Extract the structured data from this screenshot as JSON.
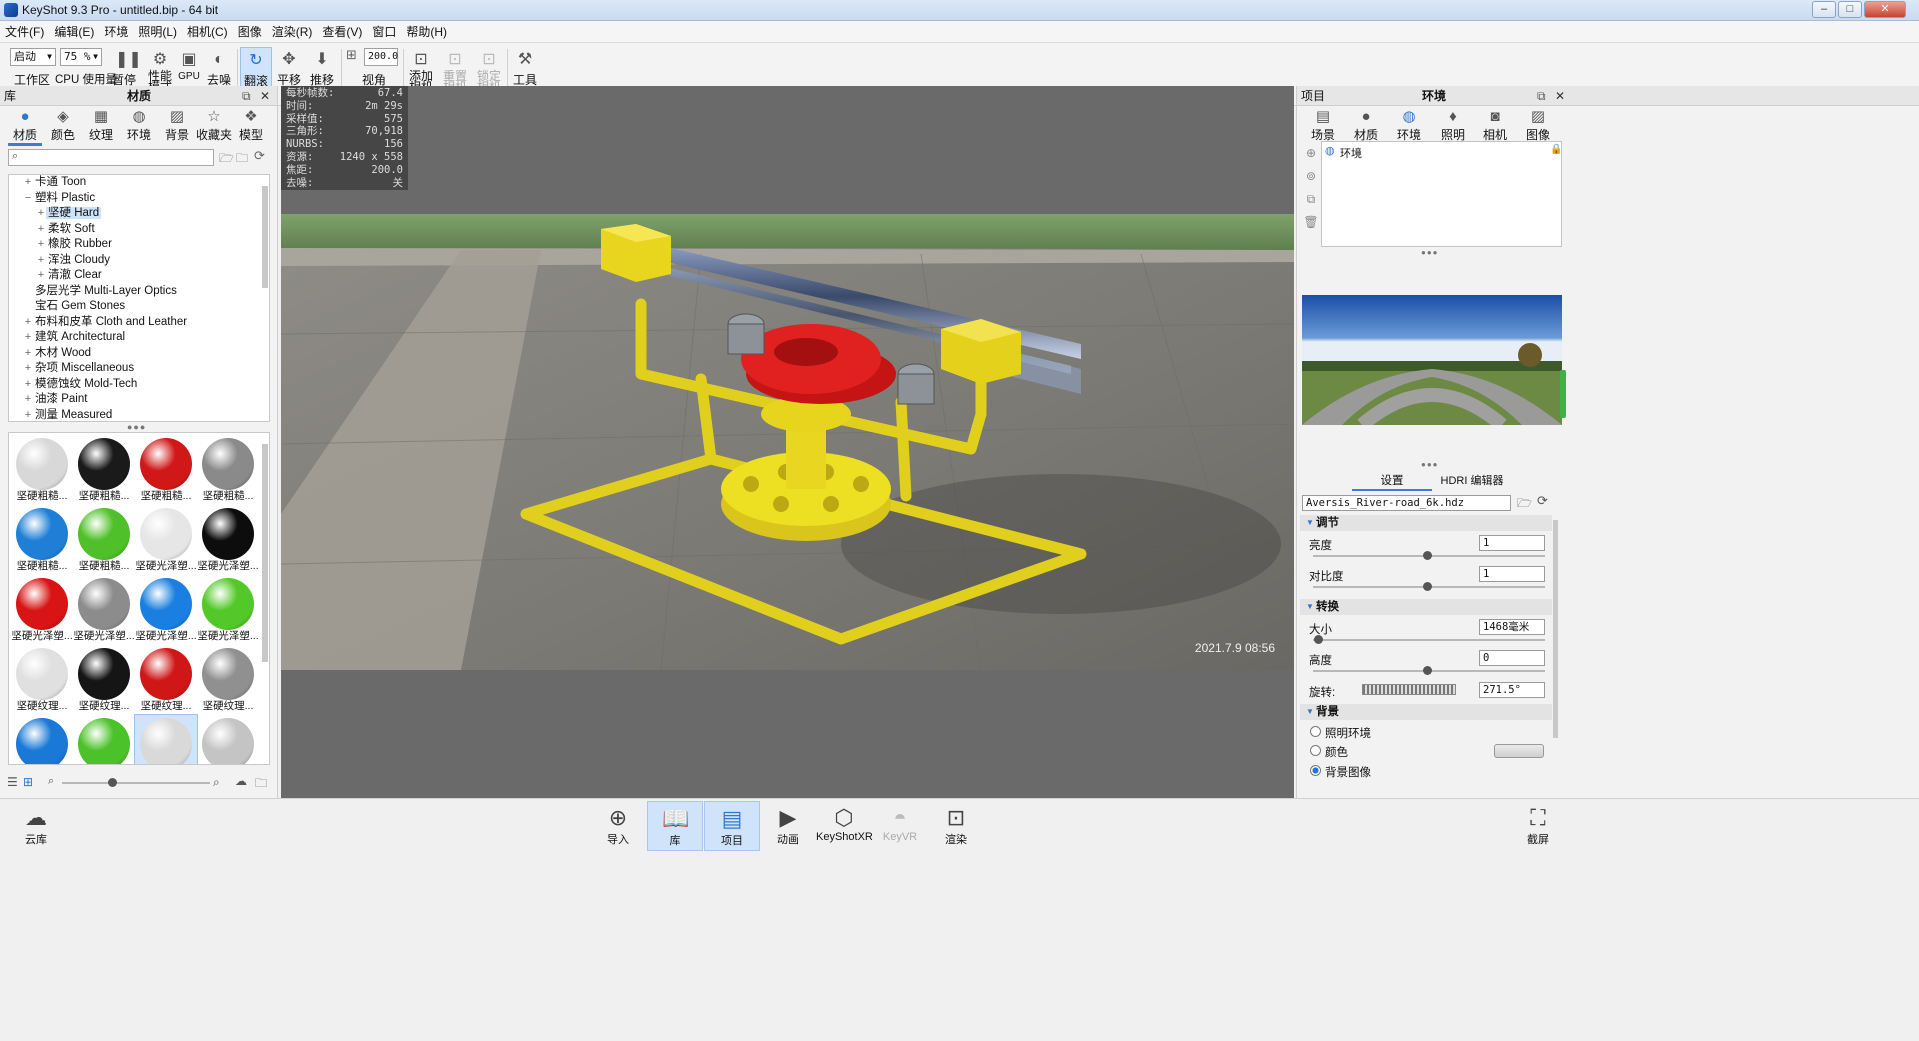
{
  "window": {
    "title": "KeyShot 9.3 Pro  - untitled.bip  - 64 bit",
    "min": "–",
    "max": "□",
    "close": "✕"
  },
  "menu": [
    "文件(F)",
    "编辑(E)",
    "环境",
    "照明(L)",
    "相机(C)",
    "图像",
    "渲染(R)",
    "查看(V)",
    "窗口",
    "帮助(H)"
  ],
  "toolbar": {
    "workspace_combo": "启动",
    "workspace_label": "工区区",
    "cpu_combo": "75 %",
    "cpu_label": "CPU 使用量",
    "pause": "暂停",
    "perf_l1": "性能",
    "perf_l2": "模式",
    "gpu": "GPU",
    "denoise": "去噪",
    "tumble": "翻滚",
    "pan": "平移",
    "dolly": "推移",
    "fov_value": "200.0",
    "fov_label": "视角",
    "add_cam_l1": "添加",
    "add_cam_l2": "相机",
    "reset_cam_l1": "重置",
    "reset_cam_l2": "相机",
    "lock_cam_l1": "锁定",
    "lock_cam_l2": "相机",
    "tools": "工具"
  },
  "library": {
    "panel_left": "库",
    "panel_title": "材质",
    "tabs": [
      "材质",
      "颜色",
      "纹理",
      "环境",
      "背景",
      "收藏夹",
      "模型"
    ],
    "tree": [
      {
        "exp": "+",
        "label": "卡通 Toon",
        "indent": 0
      },
      {
        "exp": "−",
        "label": "塑料 Plastic",
        "indent": 0
      },
      {
        "exp": "+",
        "label": "坚硬 Hard",
        "indent": 1
      },
      {
        "exp": "+",
        "label": "柔软 Soft",
        "indent": 1
      },
      {
        "exp": "+",
        "label": "橡胶 Rubber",
        "indent": 1
      },
      {
        "exp": "+",
        "label": "浑浊 Cloudy",
        "indent": 1
      },
      {
        "exp": "+",
        "label": "清澈 Clear",
        "indent": 1
      },
      {
        "exp": "",
        "label": "多层光学 Multi-Layer Optics",
        "indent": 0
      },
      {
        "exp": "",
        "label": "宝石 Gem Stones",
        "indent": 0
      },
      {
        "exp": "+",
        "label": "布料和皮革 Cloth and Leather",
        "indent": 0
      },
      {
        "exp": "+",
        "label": "建筑 Architectural",
        "indent": 0
      },
      {
        "exp": "+",
        "label": "木材 Wood",
        "indent": 0
      },
      {
        "exp": "+",
        "label": "杂项 Miscellaneous",
        "indent": 0
      },
      {
        "exp": "+",
        "label": "模德蚀纹 Mold-Tech",
        "indent": 0
      },
      {
        "exp": "+",
        "label": "油漆 Paint",
        "indent": 0
      },
      {
        "exp": "+",
        "label": "测量 Measured",
        "indent": 0
      }
    ],
    "thumbs": [
      {
        "cap": "坚硬粗糙...",
        "color": "#d8d8d8"
      },
      {
        "cap": "坚硬粗糙...",
        "color": "#1a1a1a"
      },
      {
        "cap": "坚硬粗糙...",
        "color": "#d01818"
      },
      {
        "cap": "坚硬粗糙...",
        "color": "#8a8a8a"
      },
      {
        "cap": "坚硬粗糙...",
        "color": "#1f7fd6"
      },
      {
        "cap": "坚硬粗糙...",
        "color": "#4fc02a"
      },
      {
        "cap": "坚硬光泽塑...",
        "color": "#e6e6e6"
      },
      {
        "cap": "坚硬光泽塑...",
        "color": "#0d0d0d"
      },
      {
        "cap": "坚硬光泽塑...",
        "color": "#d81414"
      },
      {
        "cap": "坚硬光泽塑...",
        "color": "#8c8c8c"
      },
      {
        "cap": "坚硬光泽塑...",
        "color": "#1a7fe0"
      },
      {
        "cap": "坚硬光泽塑...",
        "color": "#52c829"
      },
      {
        "cap": "坚硬纹理...",
        "color": "#e0e0e0"
      },
      {
        "cap": "坚硬纹理...",
        "color": "#151515"
      },
      {
        "cap": "坚硬纹理...",
        "color": "#cf1717"
      },
      {
        "cap": "坚硬纹理...",
        "color": "#909090"
      },
      {
        "cap": "",
        "color": "#1a78d6"
      },
      {
        "cap": "",
        "color": "#4cc22a"
      },
      {
        "cap": "",
        "color": "#d9d9d9"
      },
      {
        "cap": "",
        "color": "#c4c4c4"
      }
    ]
  },
  "viewport": {
    "stats": [
      {
        "k": "每秒帧数:",
        "v": "67.4"
      },
      {
        "k": "时间:",
        "v": "2m 29s"
      },
      {
        "k": "采样值:",
        "v": "575"
      },
      {
        "k": "三角形:",
        "v": "70,918"
      },
      {
        "k": "NURBS:",
        "v": "156"
      },
      {
        "k": "资源:",
        "v": "1240 x 558"
      },
      {
        "k": "焦距:",
        "v": "200.0"
      },
      {
        "k": "去噪:",
        "v": "关"
      }
    ],
    "timestamp": "2021.7.9 08:56"
  },
  "project": {
    "panel_left": "项目",
    "panel_title": "环境",
    "tabs": [
      "场景",
      "材质",
      "环境",
      "照明",
      "相机",
      "图像"
    ],
    "env_item": "环境",
    "subtabs": [
      "设置",
      "HDRI 编辑器"
    ],
    "hdri_file": "Aversis_River-road_6k.hdz",
    "sections": {
      "adjust": "调节",
      "transform": "转换",
      "background": "背景"
    },
    "brightness_label": "亮度",
    "brightness": "1",
    "contrast_label": "对比度",
    "contrast": "1",
    "size_label": "大小",
    "size": "1468毫米",
    "height_label": "高度",
    "height": "0",
    "rotation_label": "旋转:",
    "rotation": "271.5°",
    "bg_options": [
      "照明环境",
      "颜色",
      "背景图像"
    ],
    "bg_selected": 2
  },
  "dock": {
    "cloud": "云库",
    "import": "导入",
    "library": "库",
    "project": "项目",
    "animation": "动画",
    "keyshotxr": "KeyShotXR",
    "keyvr": "KeyVR",
    "render": "渲染",
    "screenshot": "截屏"
  },
  "colors": {
    "accent": "#3a7fd5",
    "selection": "#cde3f8",
    "yellow_frame": "#e3d21a",
    "red_part": "#d81c1c"
  }
}
